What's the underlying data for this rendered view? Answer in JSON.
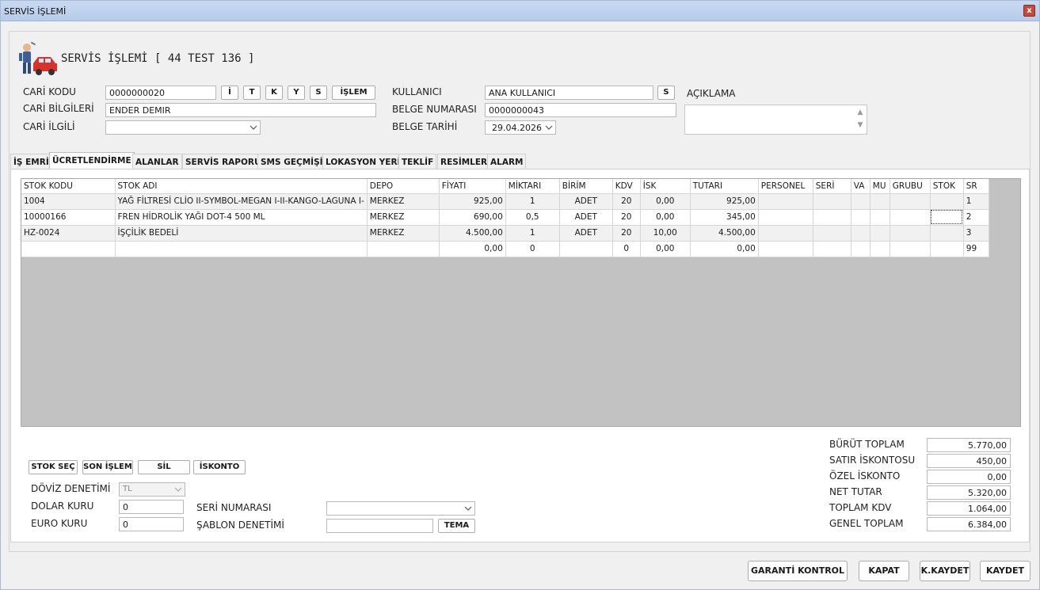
{
  "window": {
    "title": "SERVİS İŞLEMİ",
    "close_label": "x"
  },
  "header": {
    "heading": "SERVİS İŞLEMİ [ 44 TEST 136 ]"
  },
  "form": {
    "cari_kodu_label": "CARİ KODU",
    "cari_kodu_value": "0000000020",
    "btn_i": "İ",
    "btn_t": "T",
    "btn_k": "K",
    "btn_y": "Y",
    "btn_s": "S",
    "btn_islem": "İŞLEM",
    "cari_bilgileri_label": "CARİ BİLGİLERİ",
    "cari_bilgileri_value": "ENDER DEMIR",
    "cari_ilgili_label": "CARİ İLGİLİ",
    "cari_ilgili_value": "",
    "kullanici_label": "KULLANICI",
    "kullanici_value": "ANA KULLANICI",
    "kullanici_btn": "S",
    "belge_no_label": "BELGE NUMARASI",
    "belge_no_value": "0000000043",
    "belge_tarihi_label": "BELGE TARİHİ",
    "belge_tarihi_value": "29.04.2026",
    "aciklama_label": "AÇIKLAMA",
    "aciklama_value": ""
  },
  "tabs": [
    "İŞ EMRİ",
    "ÜCRETLENDİRME",
    "ALANLAR",
    "SERVİS RAPORU",
    "SMS GEÇMİŞİ",
    "LOKASYON YERİ",
    "TEKLİF",
    "RESİMLER",
    "ALARM"
  ],
  "grid": {
    "columns": [
      "STOK KODU",
      "STOK ADI",
      "DEPO",
      "FİYATI",
      "MİKTARI",
      "BİRİM",
      "KDV",
      "İSK",
      "TUTARI",
      "PERSONEL",
      "SERİ",
      "VA",
      "MU",
      "GRUBU",
      "STOK",
      "SR"
    ],
    "rows": [
      [
        "1004",
        "YAĞ FİLTRESİ CLİO II-SYMBOL-MEGAN I-II-KANGO-LAGUNA I-",
        "MERKEZ",
        "925,00",
        "1",
        "ADET",
        "20",
        "0,00",
        "925,00",
        "",
        "",
        "",
        "",
        "",
        "",
        "1"
      ],
      [
        "10000166",
        "FREN HİDROLİK YAĞI DOT-4 500 ML",
        "MERKEZ",
        "690,00",
        "0,5",
        "ADET",
        "20",
        "0,00",
        "345,00",
        "",
        "",
        "",
        "",
        "",
        "",
        "2"
      ],
      [
        "HZ-0024",
        "İŞÇİLİK BEDELİ",
        "MERKEZ",
        "4.500,00",
        "1",
        "ADET",
        "20",
        "10,00",
        "4.500,00",
        "",
        "",
        "",
        "",
        "",
        "",
        "3"
      ],
      [
        "",
        "",
        "",
        "0,00",
        "0",
        "",
        "0",
        "0,00",
        "0,00",
        "",
        "",
        "",
        "",
        "",
        "",
        "99"
      ]
    ]
  },
  "actions": {
    "stok_sec": "STOK SEÇ",
    "son_islem": "SON İŞLEM",
    "sil": "SİL",
    "iskonto": "İSKONTO"
  },
  "currency": {
    "doviz_label": "DÖVİZ DENETİMİ",
    "doviz_value": "TL",
    "dolar_label": "DOLAR KURU",
    "dolar_value": "0",
    "euro_label": "EURO KURU",
    "euro_value": "0",
    "seri_label": "SERİ NUMARASI",
    "seri_value": "",
    "sablon_label": "ŞABLON DENETİMİ",
    "sablon_value": "",
    "tema_btn": "TEMA"
  },
  "totals": [
    {
      "label": "BÜRÜT TOPLAM",
      "value": "5.770,00"
    },
    {
      "label": "SATIR İSKONTOSU",
      "value": "450,00"
    },
    {
      "label": "ÖZEL İSKONTO",
      "value": "0,00"
    },
    {
      "label": "NET TUTAR",
      "value": "5.320,00"
    },
    {
      "label": "TOPLAM KDV",
      "value": "1.064,00"
    },
    {
      "label": "GENEL TOPLAM",
      "value": "6.384,00"
    }
  ],
  "footer": {
    "garanti": "GARANTİ KONTROL",
    "kapat": "KAPAT",
    "kkaydet": "K.KAYDET",
    "kaydet": "KAYDET"
  }
}
